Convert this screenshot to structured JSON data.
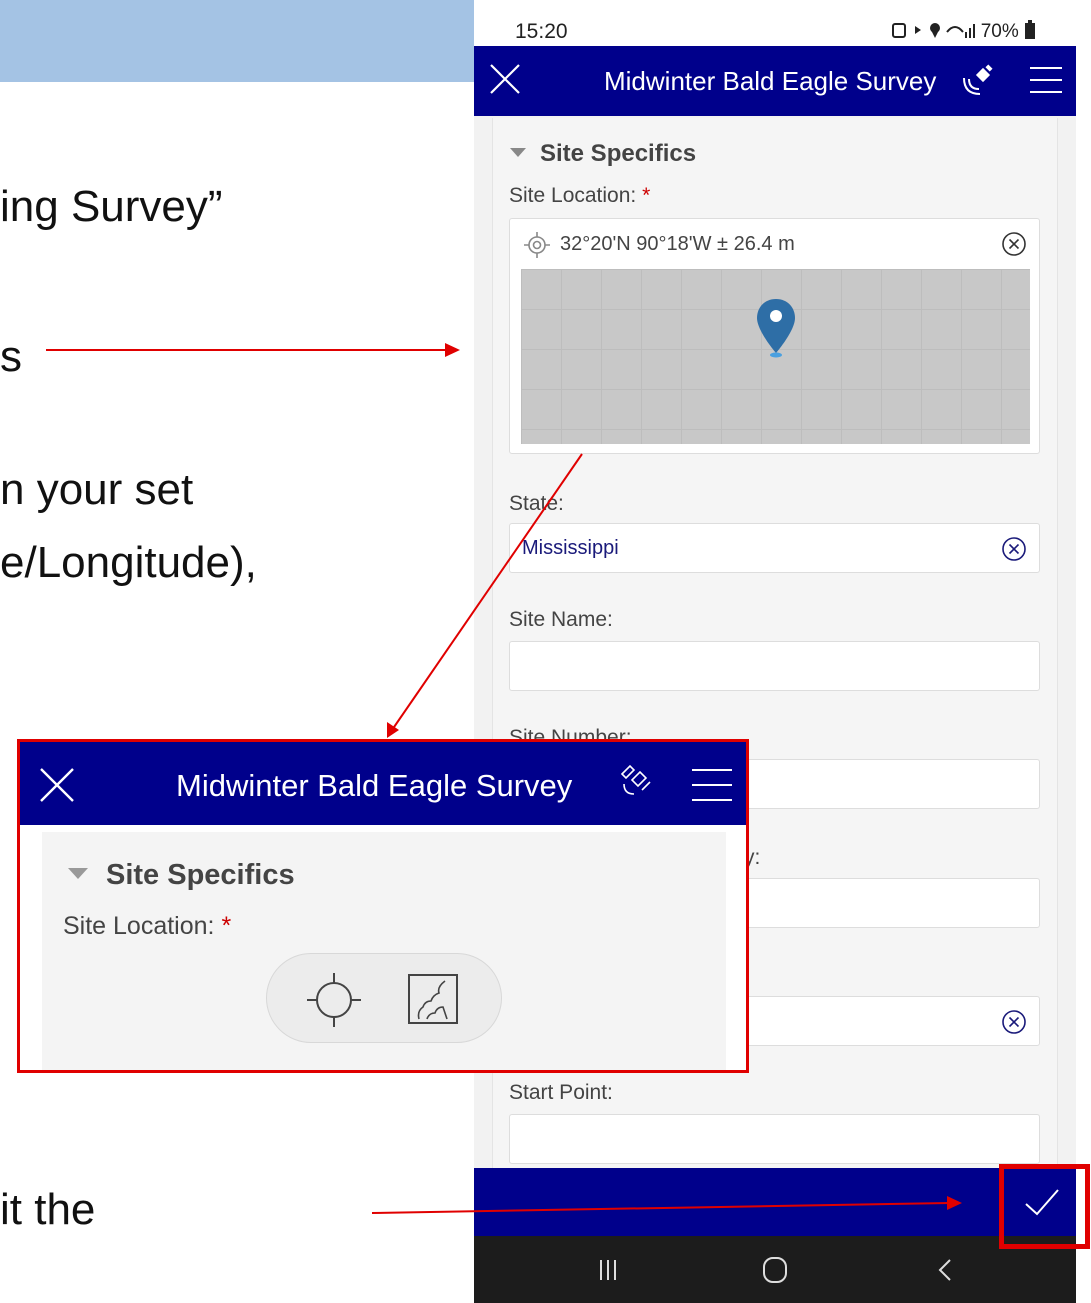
{
  "slide": {
    "line1": "ing Survey”",
    "line2": "s",
    "line3": "n your set",
    "line4": "e/Longitude),",
    "line5": "it the"
  },
  "status_bar": {
    "time": "15:20",
    "battery": "70%"
  },
  "app": {
    "title": "Midwinter Bald Eagle Survey",
    "section_title": "Site Specifics",
    "site_location_label": "Site Location:",
    "required_marker": "*",
    "location_coords": "32°20'N 90°18'W ± 26.4 m",
    "state_label": "State:",
    "state_value": "Mississippi",
    "site_name_label": "Site Name:",
    "site_number_label": "Site Number:",
    "fragment_label": "y:",
    "start_point_label": "Start Point:"
  },
  "inset": {
    "title": "Midwinter Bald Eagle Survey",
    "section_title": "Site Specifics",
    "site_location_label": "Site Location:",
    "required_marker": "*"
  },
  "colors": {
    "header_blue": "#00008b",
    "annotation_red": "#e00000",
    "slide_band": "#a4c3e4"
  },
  "icons": [
    "close-icon",
    "gps-satellite-icon",
    "menu-icon",
    "target-icon",
    "clear-icon",
    "map-pin-icon",
    "checkmark-icon",
    "recent-apps-icon",
    "home-icon",
    "back-icon",
    "map-icon"
  ]
}
